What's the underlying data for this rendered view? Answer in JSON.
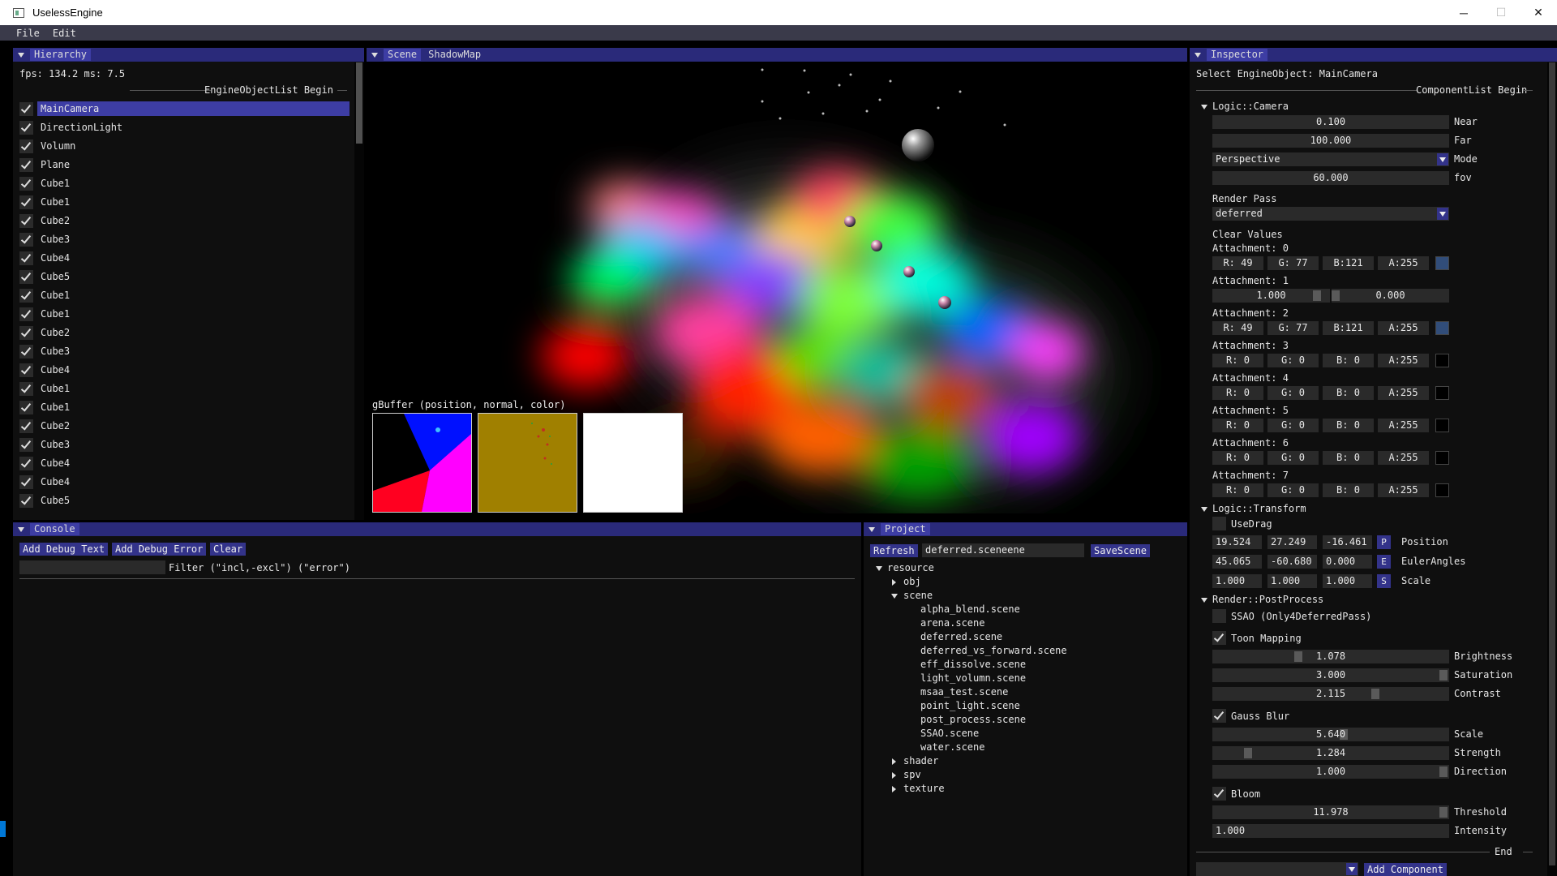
{
  "window": {
    "title": "UselessEngine",
    "minimize": "─",
    "maximize": "☐",
    "close": "✕"
  },
  "menu": [
    "File",
    "Edit"
  ],
  "hierarchy": {
    "tab": "Hierarchy",
    "fps": "fps: 134.2 ms: 7.5",
    "list_begin": "EngineObjectList Begin",
    "items": [
      "MainCamera",
      "DirectionLight",
      "Volumn",
      "Plane",
      "Cube1",
      "Cube1",
      "Cube2",
      "Cube3",
      "Cube4",
      "Cube5",
      "Cube1",
      "Cube1",
      "Cube2",
      "Cube3",
      "Cube4",
      "Cube1",
      "Cube1",
      "Cube2",
      "Cube3",
      "Cube4",
      "Cube4",
      "Cube5"
    ],
    "selected_index": 0
  },
  "scene": {
    "tabs": [
      "Scene",
      "ShadowMap"
    ],
    "gbuffer_label": "gBuffer (position, normal, color)"
  },
  "console": {
    "tab": "Console",
    "buttons": [
      "Add Debug Text",
      "Add Debug Error",
      "Clear"
    ],
    "filter_value": "",
    "filter_label": "Filter (\"incl,-excl\") (\"error\")"
  },
  "project": {
    "tab": "Project",
    "refresh": "Refresh",
    "scene_input": "deferred.sceneene",
    "save": "SaveScene",
    "tree": {
      "root": "resource",
      "obj": "obj",
      "scene": "scene",
      "scene_files": [
        "alpha_blend.scene",
        "arena.scene",
        "deferred.scene",
        "deferred_vs_forward.scene",
        "eff_dissolve.scene",
        "light_volumn.scene",
        "msaa_test.scene",
        "point_light.scene",
        "post_process.scene",
        "SSAO.scene",
        "water.scene"
      ],
      "shader": "shader",
      "spv": "spv",
      "texture": "texture"
    }
  },
  "inspector": {
    "tab": "Inspector",
    "select": "Select EngineObject: MainCamera",
    "component_begin": "ComponentList Begin",
    "camera": {
      "header": "Logic::Camera",
      "near": "0.100",
      "near_label": "Near",
      "far": "100.000",
      "far_label": "Far",
      "mode": "Perspective",
      "mode_label": "Mode",
      "fov": "60.000",
      "fov_label": "fov",
      "render_pass_label": "Render Pass",
      "render_pass": "deferred",
      "clear_values": "Clear Values",
      "attachments": [
        {
          "label": "Attachment: 0",
          "r": "R: 49",
          "g": "G: 77",
          "b": "B:121",
          "a": "A:255",
          "color": "#314d79"
        },
        {
          "label": "Attachment: 1",
          "depth": "1.000",
          "stencil": "0.000",
          "depth_fill": 0.92,
          "stencil_fill": 0.0
        },
        {
          "label": "Attachment: 2",
          "r": "R: 49",
          "g": "G: 77",
          "b": "B:121",
          "a": "A:255",
          "color": "#314d79"
        },
        {
          "label": "Attachment: 3",
          "r": "R:  0",
          "g": "G:  0",
          "b": "B:  0",
          "a": "A:255",
          "color": "#000000"
        },
        {
          "label": "Attachment: 4",
          "r": "R:  0",
          "g": "G:  0",
          "b": "B:  0",
          "a": "A:255",
          "color": "#000000"
        },
        {
          "label": "Attachment: 5",
          "r": "R:  0",
          "g": "G:  0",
          "b": "B:  0",
          "a": "A:255",
          "color": "#000000"
        },
        {
          "label": "Attachment: 6",
          "r": "R:  0",
          "g": "G:  0",
          "b": "B:  0",
          "a": "A:255",
          "color": "#000000"
        },
        {
          "label": "Attachment: 7",
          "r": "R:  0",
          "g": "G:  0",
          "b": "B:  0",
          "a": "A:255",
          "color": "#000000"
        }
      ]
    },
    "transform": {
      "header": "Logic::Transform",
      "use_drag": "UseDrag",
      "position": [
        "19.524",
        "27.249",
        "-16.461"
      ],
      "position_btn": "P",
      "position_label": "Position",
      "euler": [
        "45.065",
        "-60.680",
        "0.000"
      ],
      "euler_btn": "E",
      "euler_label": "EulerAngles",
      "scale": [
        "1.000",
        "1.000",
        "1.000"
      ],
      "scale_btn": "S",
      "scale_label": "Scale"
    },
    "postprocess": {
      "header": "Render::PostProcess",
      "ssao": "SSAO (Only4DeferredPass)",
      "toon": "Toon Mapping",
      "brightness": "1.078",
      "brightness_label": "Brightness",
      "brightness_fill": 0.36,
      "saturation": "3.000",
      "saturation_label": "Saturation",
      "saturation_fill": 1.0,
      "contrast": "2.115",
      "contrast_label": "Contrast",
      "contrast_fill": 0.7,
      "gauss": "Gauss Blur",
      "gscale": "5.640",
      "gscale_label": "Scale",
      "gscale_fill": 0.56,
      "strength": "1.284",
      "strength_label": "Strength",
      "strength_fill": 0.14,
      "direction": "1.000",
      "direction_label": "Direction",
      "direction_fill": 1.0,
      "bloom": "Bloom",
      "threshold": "11.978",
      "threshold_label": "Threshold",
      "threshold_fill": 1.0,
      "intensity": "1.000",
      "intensity_label": "Intensity"
    },
    "end": "End",
    "add_component": "Add Component"
  }
}
